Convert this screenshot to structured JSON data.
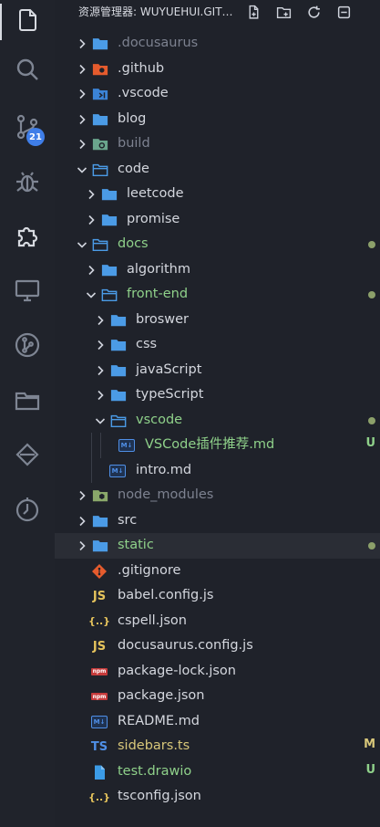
{
  "activity_bar": {
    "items": [
      {
        "name": "explorer-icon",
        "active": true
      },
      {
        "name": "search-icon"
      },
      {
        "name": "source-control-icon"
      },
      {
        "name": "debug-icon"
      },
      {
        "name": "extensions-icon"
      },
      {
        "name": "remote-explorer-icon"
      },
      {
        "name": "git-graph-icon"
      },
      {
        "name": "folder-icon"
      },
      {
        "name": "deploy-icon"
      },
      {
        "name": "timeline-icon"
      }
    ],
    "source_control_badge": "21"
  },
  "explorer": {
    "title": "资源管理器: WUYUEHUI.GITHUB.IO",
    "actions": [
      "new-file-icon",
      "new-folder-icon",
      "refresh-icon",
      "collapse-all-icon"
    ],
    "items": [
      {
        "label": ".docusaurus",
        "type": "folder",
        "depth": 0,
        "open": false,
        "color": "dim",
        "icon": "folder"
      },
      {
        "label": ".github",
        "type": "folder",
        "depth": 0,
        "open": false,
        "color": "default",
        "icon": "folder-github"
      },
      {
        "label": ".vscode",
        "type": "folder",
        "depth": 0,
        "open": false,
        "color": "default",
        "icon": "folder-vscode"
      },
      {
        "label": "blog",
        "type": "folder",
        "depth": 0,
        "open": false,
        "color": "default",
        "icon": "folder"
      },
      {
        "label": "build",
        "type": "folder",
        "depth": 0,
        "open": false,
        "color": "dim",
        "icon": "folder-build"
      },
      {
        "label": "code",
        "type": "folder",
        "depth": 0,
        "open": true,
        "color": "default",
        "icon": "folder-open"
      },
      {
        "label": "leetcode",
        "type": "folder",
        "depth": 1,
        "open": false,
        "color": "default",
        "icon": "folder"
      },
      {
        "label": "promise",
        "type": "folder",
        "depth": 1,
        "open": false,
        "color": "default",
        "icon": "folder"
      },
      {
        "label": "docs",
        "type": "folder",
        "depth": 0,
        "open": true,
        "color": "green",
        "icon": "folder-open",
        "dot": true
      },
      {
        "label": "algorithm",
        "type": "folder",
        "depth": 1,
        "open": false,
        "color": "default",
        "icon": "folder"
      },
      {
        "label": "front-end",
        "type": "folder",
        "depth": 1,
        "open": true,
        "color": "green",
        "icon": "folder-open",
        "dot": true
      },
      {
        "label": "broswer",
        "type": "folder",
        "depth": 2,
        "open": false,
        "color": "default",
        "icon": "folder"
      },
      {
        "label": "css",
        "type": "folder",
        "depth": 2,
        "open": false,
        "color": "default",
        "icon": "folder"
      },
      {
        "label": "javaScript",
        "type": "folder",
        "depth": 2,
        "open": false,
        "color": "default",
        "icon": "folder"
      },
      {
        "label": "typeScript",
        "type": "folder",
        "depth": 2,
        "open": false,
        "color": "default",
        "icon": "folder"
      },
      {
        "label": "vscode",
        "type": "folder",
        "depth": 2,
        "open": true,
        "color": "green",
        "icon": "folder-open",
        "dot": true
      },
      {
        "label": "VSCode插件推荐.md",
        "type": "file",
        "depth": 3,
        "color": "green",
        "icon": "md",
        "git": "U",
        "git_color": "green"
      },
      {
        "label": "intro.md",
        "type": "file",
        "depth": 2,
        "color": "default",
        "icon": "md"
      },
      {
        "label": "node_modules",
        "type": "folder",
        "depth": 0,
        "open": false,
        "color": "dim",
        "icon": "folder-node"
      },
      {
        "label": "src",
        "type": "folder",
        "depth": 0,
        "open": false,
        "color": "default",
        "icon": "folder"
      },
      {
        "label": "static",
        "type": "folder",
        "depth": 0,
        "open": false,
        "color": "green",
        "icon": "folder",
        "dot": true,
        "selected": true
      },
      {
        "label": ".gitignore",
        "type": "file",
        "depth": 0,
        "color": "default",
        "icon": "git"
      },
      {
        "label": "babel.config.js",
        "type": "file",
        "depth": 0,
        "color": "default",
        "icon": "js"
      },
      {
        "label": "cspell.json",
        "type": "file",
        "depth": 0,
        "color": "default",
        "icon": "json"
      },
      {
        "label": "docusaurus.config.js",
        "type": "file",
        "depth": 0,
        "color": "default",
        "icon": "js"
      },
      {
        "label": "package-lock.json",
        "type": "file",
        "depth": 0,
        "color": "default",
        "icon": "npm"
      },
      {
        "label": "package.json",
        "type": "file",
        "depth": 0,
        "color": "default",
        "icon": "npm"
      },
      {
        "label": "README.md",
        "type": "file",
        "depth": 0,
        "color": "default",
        "icon": "md"
      },
      {
        "label": "sidebars.ts",
        "type": "file",
        "depth": 0,
        "color": "yellow",
        "icon": "ts",
        "git": "M",
        "git_color": "yellow"
      },
      {
        "label": "test.drawio",
        "type": "file",
        "depth": 0,
        "color": "green",
        "icon": "drawio",
        "git": "U",
        "git_color": "green"
      },
      {
        "label": "tsconfig.json",
        "type": "file",
        "depth": 0,
        "color": "default",
        "icon": "json"
      }
    ]
  },
  "colors": {
    "folder": "#4b9be6",
    "green": "#8fd18a",
    "yellow": "#d8c77a",
    "dim": "#7d8290",
    "badge": "#3f7ee8"
  }
}
